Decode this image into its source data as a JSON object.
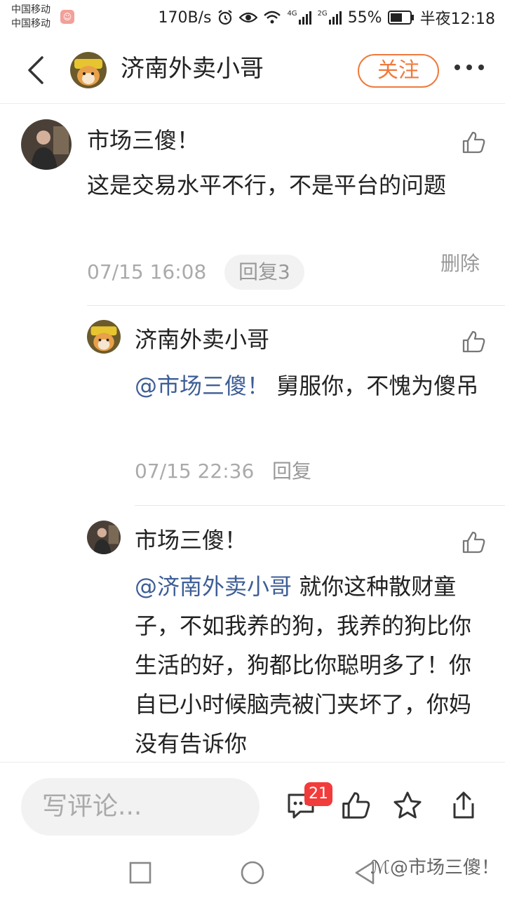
{
  "status_bar": {
    "carrier_1": "中国移动",
    "carrier_2": "中国移动",
    "speed": "170B/s",
    "network_1": "4G",
    "network_2": "2G",
    "battery": "55%",
    "time": "半夜12:18"
  },
  "header": {
    "title": "济南外卖小哥",
    "follow_label": "关注",
    "back_icon": "chevron-left-icon",
    "more_icon": "more-horizontal-icon"
  },
  "comments": [
    {
      "author": "市场三傻！",
      "text": "这是交易水平不行，不是平台的问题",
      "time": "07/15 16:08",
      "reply_label": "回复3",
      "delete_label": "删除"
    },
    {
      "author": "济南外卖小哥",
      "mention": "@市场三傻！",
      "text": " 舅服你，不愧为傻吊",
      "time": "07/15 22:36",
      "reply_label": "回复"
    },
    {
      "author": "市场三傻！",
      "mention": "@济南外卖小哥",
      "text": " 就你这种散财童子，不如我养的狗，我养的狗比你生活的好，狗都比你聪明多了！你自已小时候脑壳被门夹坏了，你妈没有告诉你"
    }
  ],
  "bottom_bar": {
    "input_placeholder": "写评论...",
    "comment_count": "21"
  },
  "watermark": "@市场三傻！",
  "colors": {
    "accent": "#f07a3c",
    "mention": "#3d5e96",
    "badge": "#f23b3b"
  }
}
